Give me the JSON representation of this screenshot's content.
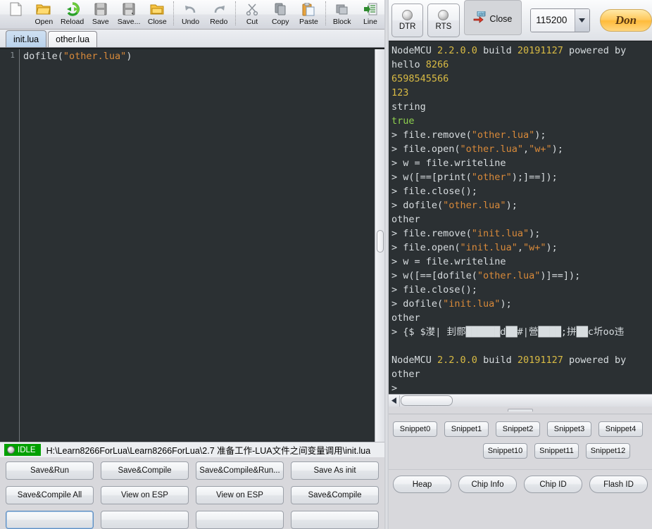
{
  "toolbar": {
    "items": [
      {
        "label": "",
        "icon": "new-file-icon"
      },
      {
        "label": "Open",
        "icon": "open-folder-icon"
      },
      {
        "label": "Reload",
        "icon": "reload-icon"
      },
      {
        "label": "Save",
        "icon": "save-icon"
      },
      {
        "label": "Save...",
        "icon": "save-as-icon"
      },
      {
        "label": "Close",
        "icon": "close-folder-icon"
      },
      {
        "label": "Undo",
        "icon": "undo-icon"
      },
      {
        "label": "Redo",
        "icon": "redo-icon"
      },
      {
        "label": "Cut",
        "icon": "scissors-icon"
      },
      {
        "label": "Copy",
        "icon": "copy-icon"
      },
      {
        "label": "Paste",
        "icon": "paste-icon"
      },
      {
        "label": "Block",
        "icon": "block-icon"
      },
      {
        "label": "Line",
        "icon": "line-icon"
      }
    ]
  },
  "tabs": [
    {
      "label": "init.lua",
      "active": true
    },
    {
      "label": "other.lua",
      "active": false
    }
  ],
  "editor": {
    "line_numbers": [
      "1"
    ],
    "code_prefix": "dofile(",
    "code_string": "\"other.lua\"",
    "code_suffix": ")"
  },
  "status": {
    "state_label": "IDLE",
    "file_path": "H:\\Learn8266ForLua\\Learn8266ForLua\\2.7 准备工作-LUA文件之间变量调用\\init.lua"
  },
  "action_buttons": [
    "Save&Run",
    "Save&Compile",
    "Save&Compile&Run...",
    "Save As init",
    "Save&Compile All",
    "View on ESP",
    "View on ESP",
    "Save&Compile"
  ],
  "serial": {
    "dtr_label": "DTR",
    "rts_label": "RTS",
    "close_label": "Close",
    "baud_value": "115200",
    "baud_arrow": "▼",
    "donate_label": "Don"
  },
  "terminal": {
    "lines": [
      {
        "segs": [
          {
            "t": "NodeMCU ",
            "c": "plain"
          },
          {
            "t": "2.2.0.0",
            "c": "num"
          },
          {
            "t": " build ",
            "c": "plain"
          },
          {
            "t": "20191127",
            "c": "num"
          },
          {
            "t": " powered by",
            "c": "plain"
          }
        ]
      },
      {
        "segs": [
          {
            "t": "hello ",
            "c": "plain"
          },
          {
            "t": "8266",
            "c": "num"
          }
        ]
      },
      {
        "segs": [
          {
            "t": "6598545566",
            "c": "num"
          }
        ]
      },
      {
        "segs": [
          {
            "t": "123",
            "c": "num"
          }
        ]
      },
      {
        "segs": [
          {
            "t": "string",
            "c": "plain"
          }
        ]
      },
      {
        "segs": [
          {
            "t": "true",
            "c": "grn"
          }
        ]
      },
      {
        "segs": [
          {
            "t": "> file.remove(",
            "c": "plain"
          },
          {
            "t": "\"other.lua\"",
            "c": "str"
          },
          {
            "t": ");",
            "c": "plain"
          }
        ]
      },
      {
        "segs": [
          {
            "t": "> file.open(",
            "c": "plain"
          },
          {
            "t": "\"other.lua\"",
            "c": "str"
          },
          {
            "t": ",",
            "c": "plain"
          },
          {
            "t": "\"w+\"",
            "c": "str"
          },
          {
            "t": ");",
            "c": "plain"
          }
        ]
      },
      {
        "segs": [
          {
            "t": "> w = file.writeline",
            "c": "plain"
          }
        ]
      },
      {
        "segs": [
          {
            "t": "> w([==[print(",
            "c": "plain"
          },
          {
            "t": "\"other\"",
            "c": "str"
          },
          {
            "t": ");]==]);",
            "c": "plain"
          }
        ]
      },
      {
        "segs": [
          {
            "t": "> file.close();",
            "c": "plain"
          }
        ]
      },
      {
        "segs": [
          {
            "t": "> dofile(",
            "c": "plain"
          },
          {
            "t": "\"other.lua\"",
            "c": "str"
          },
          {
            "t": ");",
            "c": "plain"
          }
        ]
      },
      {
        "segs": [
          {
            "t": "other",
            "c": "plain"
          }
        ]
      },
      {
        "segs": [
          {
            "t": "> file.remove(",
            "c": "plain"
          },
          {
            "t": "\"init.lua\"",
            "c": "str"
          },
          {
            "t": ");",
            "c": "plain"
          }
        ]
      },
      {
        "segs": [
          {
            "t": "> file.open(",
            "c": "plain"
          },
          {
            "t": "\"init.lua\"",
            "c": "str"
          },
          {
            "t": ",",
            "c": "plain"
          },
          {
            "t": "\"w+\"",
            "c": "str"
          },
          {
            "t": ");",
            "c": "plain"
          }
        ]
      },
      {
        "segs": [
          {
            "t": "> w = file.writeline",
            "c": "plain"
          }
        ]
      },
      {
        "segs": [
          {
            "t": "> w([==[dofile(",
            "c": "plain"
          },
          {
            "t": "\"other.lua\"",
            "c": "str"
          },
          {
            "t": ")]==]);",
            "c": "plain"
          }
        ]
      },
      {
        "segs": [
          {
            "t": "> file.close();",
            "c": "plain"
          }
        ]
      },
      {
        "segs": [
          {
            "t": "> dofile(",
            "c": "plain"
          },
          {
            "t": "\"init.lua\"",
            "c": "str"
          },
          {
            "t": ");",
            "c": "plain"
          }
        ]
      },
      {
        "segs": [
          {
            "t": "other",
            "c": "plain"
          }
        ]
      },
      {
        "segs": [
          {
            "t": "> {$ $漤| 刲郻██████d██#|營████;拼██c圻oo违",
            "c": "garb"
          }
        ]
      },
      {
        "segs": [
          {
            "t": "",
            "c": "plain"
          }
        ]
      },
      {
        "segs": [
          {
            "t": "NodeMCU ",
            "c": "plain"
          },
          {
            "t": "2.2.0.0",
            "c": "num"
          },
          {
            "t": " build ",
            "c": "plain"
          },
          {
            "t": "20191127",
            "c": "num"
          },
          {
            "t": " powered by",
            "c": "plain"
          }
        ]
      },
      {
        "segs": [
          {
            "t": "other",
            "c": "plain"
          }
        ]
      },
      {
        "segs": [
          {
            "t": ">",
            "c": "plain"
          }
        ]
      }
    ],
    "annotation_arrow_color": "#e83030"
  },
  "snippets": {
    "row1": [
      "Snippet0",
      "Snippet1",
      "Snippet2",
      "Snippet3",
      "Snippet4"
    ],
    "row2": [
      "Snippet10",
      "Snippet11",
      "Snippet12"
    ]
  },
  "info_buttons": [
    "Heap",
    "Chip Info",
    "Chip ID",
    "Flash ID"
  ],
  "colors": {
    "terminal_bg": "#2b3033",
    "terminal_text": "#d8dde0",
    "string_orange": "#d98a3a",
    "number_yellow": "#d9bb44",
    "bool_green": "#8fd14f",
    "idle_green": "#00a000",
    "arrow_red": "#e83030",
    "tab_active_blue": "#b9d2ec",
    "donate_orange": "#ffc85a"
  }
}
